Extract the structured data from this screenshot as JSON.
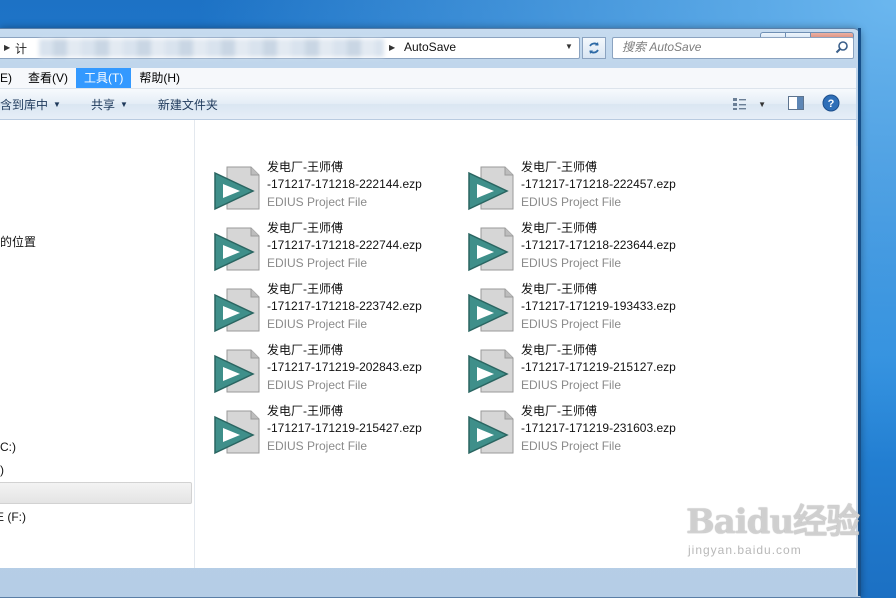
{
  "window": {
    "caption": {
      "min": "minimize",
      "max": "maximize",
      "close": "×"
    }
  },
  "address": {
    "first_segment": "计",
    "current_folder": "AutoSave",
    "dropdown_icon": "chevron-down-icon",
    "refresh_icon": "refresh-arrows-icon"
  },
  "search": {
    "placeholder": "搜索 AutoSave"
  },
  "menu": {
    "items": [
      {
        "label": "E)"
      },
      {
        "label": "查看(V)"
      },
      {
        "label": "工具(T)",
        "active": true
      },
      {
        "label": "帮助(H)"
      }
    ]
  },
  "toolbar": {
    "include_library": "含到库中",
    "share": "共享",
    "new_folder": "新建文件夹"
  },
  "nav": {
    "recent_places": "的位置",
    "drive_c": "C:)",
    "drive_d": ")",
    "drive_f": "E (F:)"
  },
  "files": [
    {
      "name1": "发电厂-王师傅",
      "name2": "-171217-171218-222144.ezp",
      "type": "EDIUS Project File"
    },
    {
      "name1": "发电厂-王师傅",
      "name2": "-171217-171218-222457.ezp",
      "type": "EDIUS Project File"
    },
    {
      "name1": "发电厂-王师傅",
      "name2": "-171217-171218-222744.ezp",
      "type": "EDIUS Project File"
    },
    {
      "name1": "发电厂-王师傅",
      "name2": "-171217-171218-223644.ezp",
      "type": "EDIUS Project File"
    },
    {
      "name1": "发电厂-王师傅",
      "name2": "-171217-171218-223742.ezp",
      "type": "EDIUS Project File"
    },
    {
      "name1": "发电厂-王师傅",
      "name2": "-171217-171219-193433.ezp",
      "type": "EDIUS Project File"
    },
    {
      "name1": "发电厂-王师傅",
      "name2": "-171217-171219-202843.ezp",
      "type": "EDIUS Project File"
    },
    {
      "name1": "发电厂-王师傅",
      "name2": "-171217-171219-215127.ezp",
      "type": "EDIUS Project File"
    },
    {
      "name1": "发电厂-王师傅",
      "name2": "-171217-171219-215427.ezp",
      "type": "EDIUS Project File"
    },
    {
      "name1": "发电厂-王师傅",
      "name2": "-171217-171219-231603.ezp",
      "type": "EDIUS Project File"
    }
  ],
  "watermark": {
    "big": "Baidu经验",
    "small": "jingyan.baidu.com"
  },
  "colors": {
    "menu_active": "#3399ff",
    "icon_teal": "#3f8f8a",
    "desktop": "#1f78cf"
  }
}
